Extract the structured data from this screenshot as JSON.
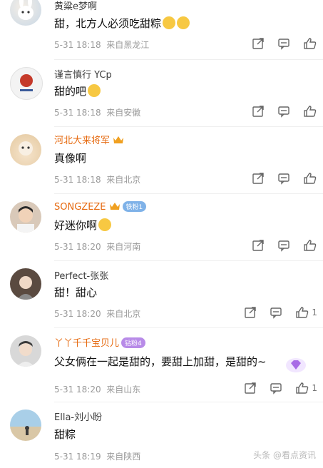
{
  "colors": {
    "vip_name": "#e66a10",
    "meta": "#9a9a9a",
    "divider": "#efefef"
  },
  "comments": [
    {
      "name": "黄粱e梦啊",
      "text": "甜，北方人必须吃甜粽",
      "date": "5-31 18:18",
      "location": "来自黑龙江",
      "like_count": ""
    },
    {
      "name": "谨言慎行 YCp",
      "text": "甜的吧",
      "date": "5-31 18:18",
      "location": "来自安徽",
      "like_count": ""
    },
    {
      "name": "河北大来将军",
      "text": "真像啊",
      "date": "5-31 18:18",
      "location": "来自北京",
      "like_count": ""
    },
    {
      "name": "SONGZEZE",
      "badge": "铁粉1",
      "text": "好迷你啊",
      "date": "5-31 18:20",
      "location": "来自河南",
      "like_count": ""
    },
    {
      "name": "Perfect-张张",
      "text": "甜！甜心",
      "date": "5-31 18:20",
      "location": "来自北京",
      "like_count": "1"
    },
    {
      "name": "丫丫千千宝贝儿",
      "badge": "钻粉4",
      "text": "父女俩在一起是甜的，要甜上加甜，是甜的~",
      "date": "5-31 18:20",
      "location": "来自山东",
      "like_count": "1"
    },
    {
      "name": "Ella-刘小盼",
      "text": "甜粽",
      "date": "5-31 18:19",
      "location": "来自陕西",
      "like_count": ""
    }
  ],
  "icons": {
    "share": "share-icon",
    "reply": "comment-icon",
    "like": "thumbs-up-icon"
  },
  "watermark": "头条 @看点资讯"
}
